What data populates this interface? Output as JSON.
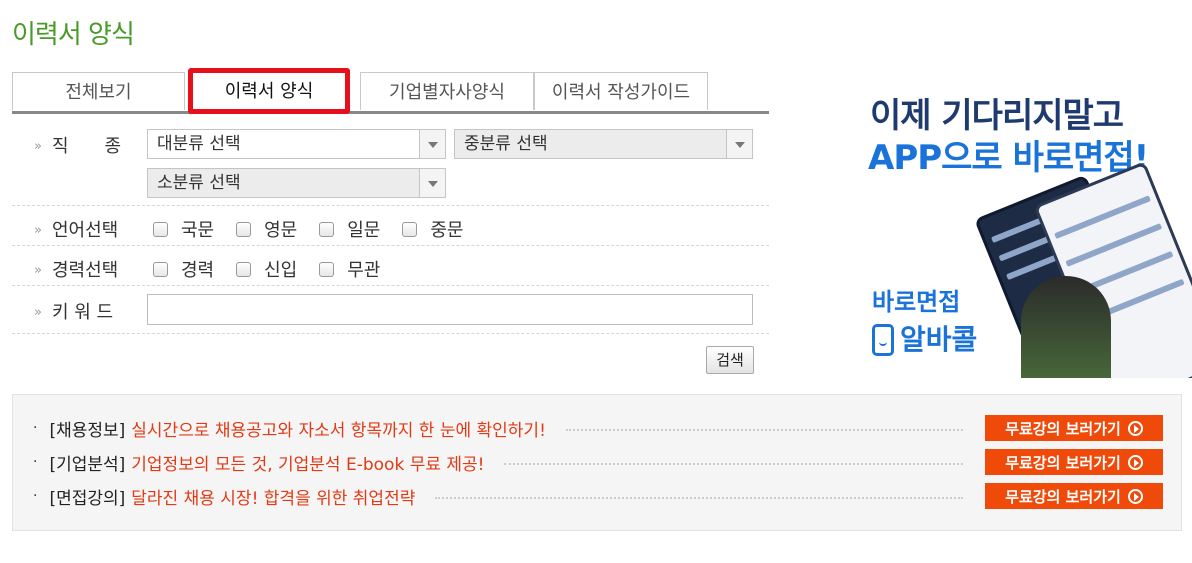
{
  "page": {
    "title": "이력서 양식"
  },
  "tabs": [
    {
      "label": "전체보기"
    },
    {
      "label": "이력서 양식"
    },
    {
      "label": "기업별자사양식"
    },
    {
      "label": "이력서 작성가이드"
    }
  ],
  "form": {
    "job_type": {
      "label": "직　　종",
      "major": "대분류 선택",
      "middle": "중분류 선택",
      "minor": "소분류 선택"
    },
    "language": {
      "label": "언어선택",
      "options": [
        "국문",
        "영문",
        "일문",
        "중문"
      ]
    },
    "career": {
      "label": "경력선택",
      "options": [
        "경력",
        "신입",
        "무관"
      ]
    },
    "keyword": {
      "label": "키 워 드",
      "value": ""
    },
    "search_label": "검색"
  },
  "ad": {
    "line1": "이제 기다리지말고",
    "line2_app": "APP으로",
    "line2_rest": "바로면접!",
    "brand1": "바로면접",
    "brand2": "알바콜"
  },
  "notices": [
    {
      "category": "[채용정보]",
      "message": "실시간으로 채용공고와 자소서 항목까지 한 눈에 확인하기!",
      "button": "무료강의 보러가기"
    },
    {
      "category": "[기업분석]",
      "message": "기업정보의 모든 것, 기업분석 E-book 무료 제공!",
      "button": "무료강의 보러가기"
    },
    {
      "category": "[면접강의]",
      "message": "달라진 채용 시장! 합격을 위한 취업전략",
      "button": "무료강의 보러가기"
    }
  ],
  "colors": {
    "title_green": "#4a9a2a",
    "highlight_red": "#e5101c",
    "notice_orange": "#f04a0b",
    "ad_blue": "#1a73d9"
  }
}
